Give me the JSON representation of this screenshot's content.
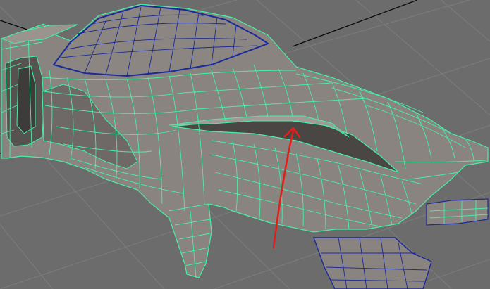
{
  "viewport": {
    "background_color": "#6c6c6c",
    "grid_color": "#7d7d7d",
    "axis_color": "#0a0a0a"
  },
  "model": {
    "body_color": "#8a8480",
    "shadow_color": "#565250",
    "dark_color": "#3e3c3b",
    "light_color": "#a09a96",
    "wire_selected_color": "#45f0a6",
    "wire_unselected_color": "#1a2a9a"
  },
  "annotation": {
    "arrow_color": "#e0201a",
    "arrow_icon": "red-arrow-icon"
  }
}
